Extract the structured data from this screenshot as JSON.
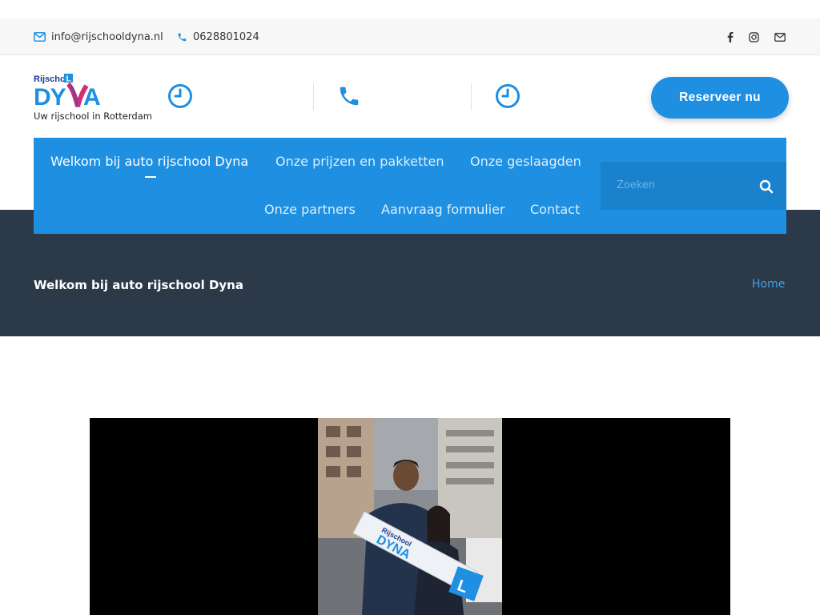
{
  "topbar": {
    "email": "info@rijschooldyna.nl",
    "phone": "0628801024",
    "social": [
      "facebook-icon",
      "instagram-icon",
      "mail-icon"
    ]
  },
  "header": {
    "logo_text_top": "Rijschool",
    "logo_text_main": "DYNA",
    "tagline": "Uw rijschool in Rotterdam",
    "info_icons": [
      "clock-icon",
      "phone-icon",
      "clock-icon"
    ],
    "reserve_label": "Reserveer nu"
  },
  "nav": {
    "items": [
      {
        "label": "Welkom bij auto rijschool Dyna",
        "active": true
      },
      {
        "label": "Onze prijzen en pakketten"
      },
      {
        "label": "Onze geslaagden"
      },
      {
        "label": "Onze partners"
      },
      {
        "label": "Aanvraag formulier"
      },
      {
        "label": "Contact"
      }
    ],
    "search_placeholder": "Zoeken"
  },
  "hero": {
    "title": "Welkom bij auto rijschool Dyna",
    "breadcrumb": "Home"
  },
  "video": {
    "sign_text": "Rijschool DYNA",
    "plate_letter": "L"
  },
  "colors": {
    "accent": "#1e8fe1",
    "hero_bg": "#2c3949",
    "topbar_bg": "#f7f7f7"
  }
}
